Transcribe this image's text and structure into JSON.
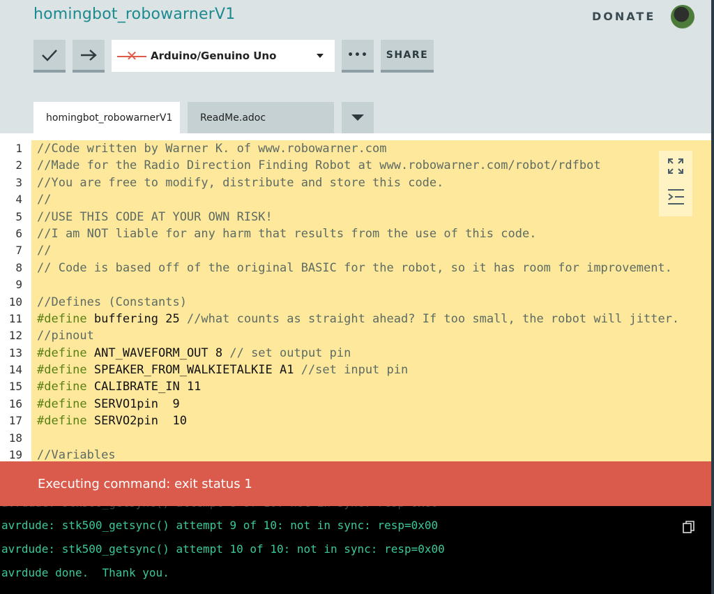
{
  "header": {
    "sketch_title": "homingbot_robowarnerV1",
    "donate_label": "DONATE",
    "avatar_icon": "avatar-image"
  },
  "toolbar": {
    "verify_icon": "checkmark-icon",
    "upload_icon": "arrow-right-icon",
    "board_status_icon": "disconnected-x-icon",
    "board_name": "Arduino/Genuino Uno",
    "more_label": "•••",
    "share_label": "SHARE"
  },
  "tabs": [
    {
      "label": "homingbot_robowarnerV1"
    },
    {
      "label": "ReadMe.adoc"
    }
  ],
  "editor": {
    "tools": [
      "fullscreen-icon",
      "indent-icon"
    ],
    "lines": [
      {
        "n": "1",
        "parts": [
          {
            "t": "//Code written by Warner K. of www.robowarner.com",
            "c": "c"
          }
        ]
      },
      {
        "n": "2",
        "parts": [
          {
            "t": "//Made for the Radio Direction Finding Robot at www.robowarner.com/robot/rdfbot",
            "c": "c"
          }
        ]
      },
      {
        "n": "3",
        "parts": [
          {
            "t": "//You are free to modify, distribute and store this code.",
            "c": "c"
          }
        ]
      },
      {
        "n": "4",
        "parts": [
          {
            "t": "//",
            "c": "c"
          }
        ]
      },
      {
        "n": "5",
        "parts": [
          {
            "t": "//USE THIS CODE AT YOUR OWN RISK!",
            "c": "c"
          }
        ]
      },
      {
        "n": "6",
        "parts": [
          {
            "t": "//I am NOT liable for any harm that results from the use of this code.",
            "c": "c"
          }
        ]
      },
      {
        "n": "7",
        "parts": [
          {
            "t": "//",
            "c": "c"
          }
        ]
      },
      {
        "n": "8",
        "parts": [
          {
            "t": "// Code is based off of the original BASIC for the robot, so it has room for improvement.",
            "c": "c"
          }
        ]
      },
      {
        "n": "9",
        "parts": []
      },
      {
        "n": "10",
        "parts": [
          {
            "t": "//Defines (Constants)",
            "c": "c"
          }
        ]
      },
      {
        "n": "11",
        "parts": [
          {
            "t": "#define",
            "c": "k"
          },
          {
            "t": " buffering 25 ",
            "c": ""
          },
          {
            "t": "//what counts as straight ahead? If too small, the robot will jitter.",
            "c": "c"
          }
        ]
      },
      {
        "n": "12",
        "parts": [
          {
            "t": "//pinout",
            "c": "c"
          }
        ]
      },
      {
        "n": "13",
        "parts": [
          {
            "t": "#define",
            "c": "k"
          },
          {
            "t": " ANT_WAVEFORM_OUT 8 ",
            "c": ""
          },
          {
            "t": "// set output pin",
            "c": "c"
          }
        ]
      },
      {
        "n": "14",
        "parts": [
          {
            "t": "#define",
            "c": "k"
          },
          {
            "t": " SPEAKER_FROM_WALKIETALKIE A1 ",
            "c": ""
          },
          {
            "t": "//set input pin",
            "c": "c"
          }
        ]
      },
      {
        "n": "15",
        "parts": [
          {
            "t": "#define",
            "c": "k"
          },
          {
            "t": " CALIBRATE_IN 11",
            "c": ""
          }
        ]
      },
      {
        "n": "16",
        "parts": [
          {
            "t": "#define",
            "c": "k"
          },
          {
            "t": " SERVO1pin  9",
            "c": ""
          }
        ]
      },
      {
        "n": "17",
        "parts": [
          {
            "t": "#define",
            "c": "k"
          },
          {
            "t": " SERVO2pin  10",
            "c": ""
          }
        ]
      },
      {
        "n": "18",
        "parts": []
      },
      {
        "n": "19",
        "parts": [
          {
            "t": "//Variables",
            "c": "c"
          }
        ]
      }
    ]
  },
  "status_bar": {
    "message": "Executing command: exit status 1"
  },
  "console": {
    "copy_icon": "copy-icon",
    "lines": [
      "avrdude: stk500_getsync() attempt 9 of 10: not in sync: resp=0x00",
      "avrdude: stk500_getsync() attempt 10 of 10: not in sync: resp=0x00",
      "avrdude done.  Thank you."
    ]
  }
}
